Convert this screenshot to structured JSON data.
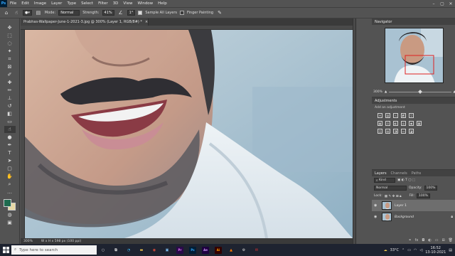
{
  "menu": {
    "logo": "Ps",
    "items": [
      "File",
      "Edit",
      "Image",
      "Layer",
      "Type",
      "Select",
      "Filter",
      "3D",
      "View",
      "Window",
      "Help"
    ],
    "window_controls": [
      "–",
      "▢",
      "✕"
    ]
  },
  "options": {
    "mode_label": "Mode:",
    "mode_value": "Normal",
    "strength_label": "Strength:",
    "strength_value": "41%",
    "angle_value": "1°",
    "sample_all_layers": "Sample All Layers",
    "finger_painting": "Finger Painting"
  },
  "document": {
    "tab_title": "Prabhas-Wallpaper-June-1-2021-3.jpg @ 300% (Layer 1, RGB/8#) *",
    "tab_close": "×",
    "status_zoom": "300%",
    "status_doc": "W x H x 598 px (100 ppi)"
  },
  "navigator": {
    "title": "Navigator",
    "zoom": "300%"
  },
  "adjustments": {
    "tab_label": "Adjustments",
    "hint": "Add an adjustment"
  },
  "layers": {
    "tabs": [
      "Layers",
      "Channels",
      "Paths"
    ],
    "kind_label": "Kind",
    "blend_mode": "Normal",
    "opacity_label": "Opacity:",
    "opacity_value": "100%",
    "lock_label": "Lock:",
    "fill_label": "Fill:",
    "fill_value": "100%",
    "items": [
      {
        "name": "Layer 1",
        "selected": true
      },
      {
        "name": "Background",
        "selected": false
      }
    ]
  },
  "taskbar": {
    "search_placeholder": "Type here to search",
    "apps": [
      {
        "label": "Pr",
        "color": "#2a0a4a",
        "fg": "#ea77ff"
      },
      {
        "label": "Ps",
        "color": "#001e36",
        "fg": "#31a8ff"
      },
      {
        "label": "Ae",
        "color": "#1f0040",
        "fg": "#cf96fd"
      },
      {
        "label": "Ai",
        "color": "#330000",
        "fg": "#ff9a00"
      }
    ],
    "temperature": "33°C",
    "time": "16:52",
    "date": "13-10-2021"
  }
}
